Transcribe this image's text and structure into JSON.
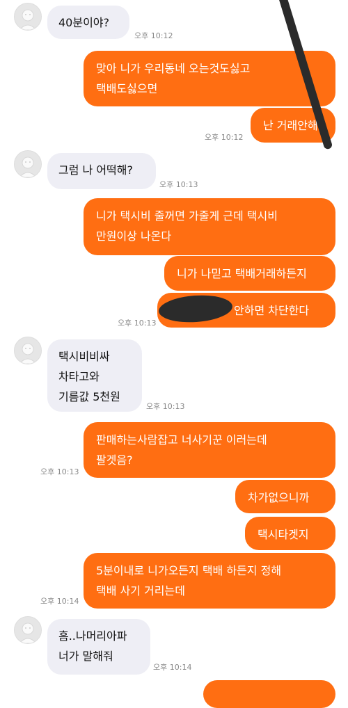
{
  "colors": {
    "outgoing_bubble": "#ff6e12",
    "incoming_bubble": "#eeeef5",
    "timestamp": "#888888"
  },
  "messages": [
    {
      "direction": "in",
      "lines": [
        "40분이야?"
      ],
      "time": "오후 10:12",
      "avatar": true
    },
    {
      "direction": "out",
      "lines": [
        "맞아 니가 우리동네 오는것도싫고",
        "택배도싫으면"
      ]
    },
    {
      "direction": "out",
      "lines": [
        "난 거래안해"
      ],
      "time": "오후 10:12"
    },
    {
      "direction": "in",
      "lines": [
        "그럼 나 어떡해?"
      ],
      "time": "오후 10:13",
      "avatar": true
    },
    {
      "direction": "out",
      "lines": [
        "니가 택시비 줄꺼면 가줄게 근데 택시비",
        "만원이상 나온다"
      ]
    },
    {
      "direction": "out",
      "lines": [
        "니가 나믿고 택배거래하든지"
      ]
    },
    {
      "direction": "out",
      "lines": [
        "안하면 차단한다"
      ],
      "time": "오후 10:13",
      "redacted": true
    },
    {
      "direction": "in",
      "lines": [
        "택시비비싸",
        "차타고와",
        "기름값 5천원"
      ],
      "time": "오후 10:13",
      "avatar": true
    },
    {
      "direction": "out",
      "lines": [
        "판매하는사람잡고 너사기꾼 이러는데",
        "팔겟음?"
      ],
      "time": "오후 10:13"
    },
    {
      "direction": "out",
      "lines": [
        "차가없으니까"
      ]
    },
    {
      "direction": "out",
      "lines": [
        "택시타겟지"
      ]
    },
    {
      "direction": "out",
      "lines": [
        "5분이내로 니가오든지 택배 하든지 정해",
        "택배 사기 거리는데"
      ],
      "time": "오후 10:14"
    },
    {
      "direction": "in",
      "lines": [
        "흠..나머리아파",
        "너가 말해줘"
      ],
      "time": "오후 10:14",
      "avatar": true
    },
    {
      "direction": "out",
      "lines": [
        ""
      ]
    }
  ]
}
